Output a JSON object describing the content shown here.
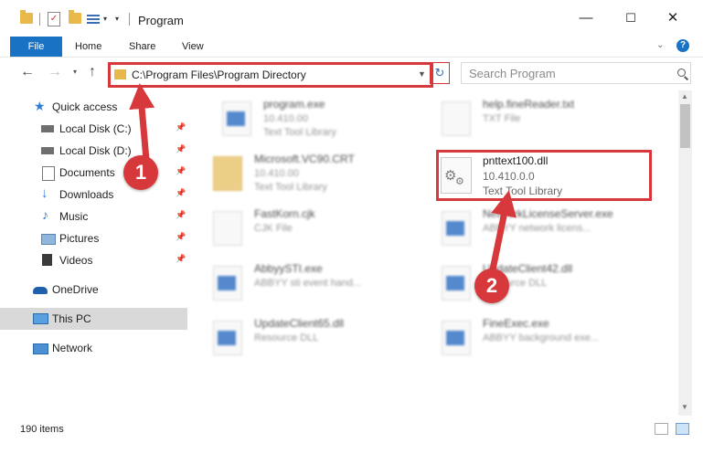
{
  "window": {
    "title": "Program"
  },
  "ribbon": {
    "tabs": [
      "File",
      "Home",
      "Share",
      "View"
    ]
  },
  "address_bar": {
    "path": "C:\\Program Files\\Program Directory",
    "search_placeholder": "Search Program"
  },
  "sidebar": {
    "items": [
      {
        "label": "Quick access",
        "icon": "star-icon",
        "pinned": false
      },
      {
        "label": "Local Disk (C:)",
        "icon": "drive-icon",
        "pinned": true
      },
      {
        "label": "Local Disk (D:)",
        "icon": "drive-icon",
        "pinned": true
      },
      {
        "label": "Documents",
        "icon": "documents-icon",
        "pinned": true
      },
      {
        "label": "Downloads",
        "icon": "download-icon",
        "pinned": true
      },
      {
        "label": "Music",
        "icon": "music-icon",
        "pinned": true
      },
      {
        "label": "Pictures",
        "icon": "pictures-icon",
        "pinned": true
      },
      {
        "label": "Videos",
        "icon": "videos-icon",
        "pinned": true
      },
      {
        "label": "OneDrive",
        "icon": "cloud-icon",
        "pinned": false
      },
      {
        "label": "This PC",
        "icon": "computer-icon",
        "pinned": false,
        "selected": true
      },
      {
        "label": "Network",
        "icon": "network-icon",
        "pinned": false
      }
    ]
  },
  "files": [
    {
      "name": "program.exe",
      "line2": "10.410.00",
      "line3": "Text Tool Library",
      "icon": "exe"
    },
    {
      "name": "help.fineReader.txt",
      "line2": "TXT File",
      "line3": "",
      "icon": "doc"
    },
    {
      "name": "Microsoft.VC90.CRT",
      "line2": "10.410.00",
      "line3": "Text Tool Library",
      "icon": "folder"
    },
    {
      "name": "FastKorn.cjk",
      "line2": "CJK File",
      "line3": "",
      "icon": "doc"
    },
    {
      "name": "NetworkLicenseServer.exe",
      "line2": "ABBYY network licens...",
      "line3": "",
      "icon": "exe"
    },
    {
      "name": "AbbyySTI.exe",
      "line2": "ABBYY sti event hand...",
      "line3": "",
      "icon": "exe"
    },
    {
      "name": "UpdateClient42.dll",
      "line2": "Resource DLL",
      "line3": "",
      "icon": "exe"
    },
    {
      "name": "UpdateClient65.dll",
      "line2": "Resource DLL",
      "line3": "",
      "icon": "exe"
    },
    {
      "name": "FineExec.exe",
      "line2": "ABBYY background exe...",
      "line3": "",
      "icon": "exe"
    }
  ],
  "highlighted_file": {
    "name": "pnttext100.dll",
    "version": "10.410.0.0",
    "type": "Text Tool Library"
  },
  "status": {
    "item_count": "190 items"
  },
  "callouts": [
    "1",
    "2"
  ],
  "colors": {
    "accent": "#1a72c4",
    "highlight_red": "#d7383b",
    "selection": "#d9d9d9"
  }
}
